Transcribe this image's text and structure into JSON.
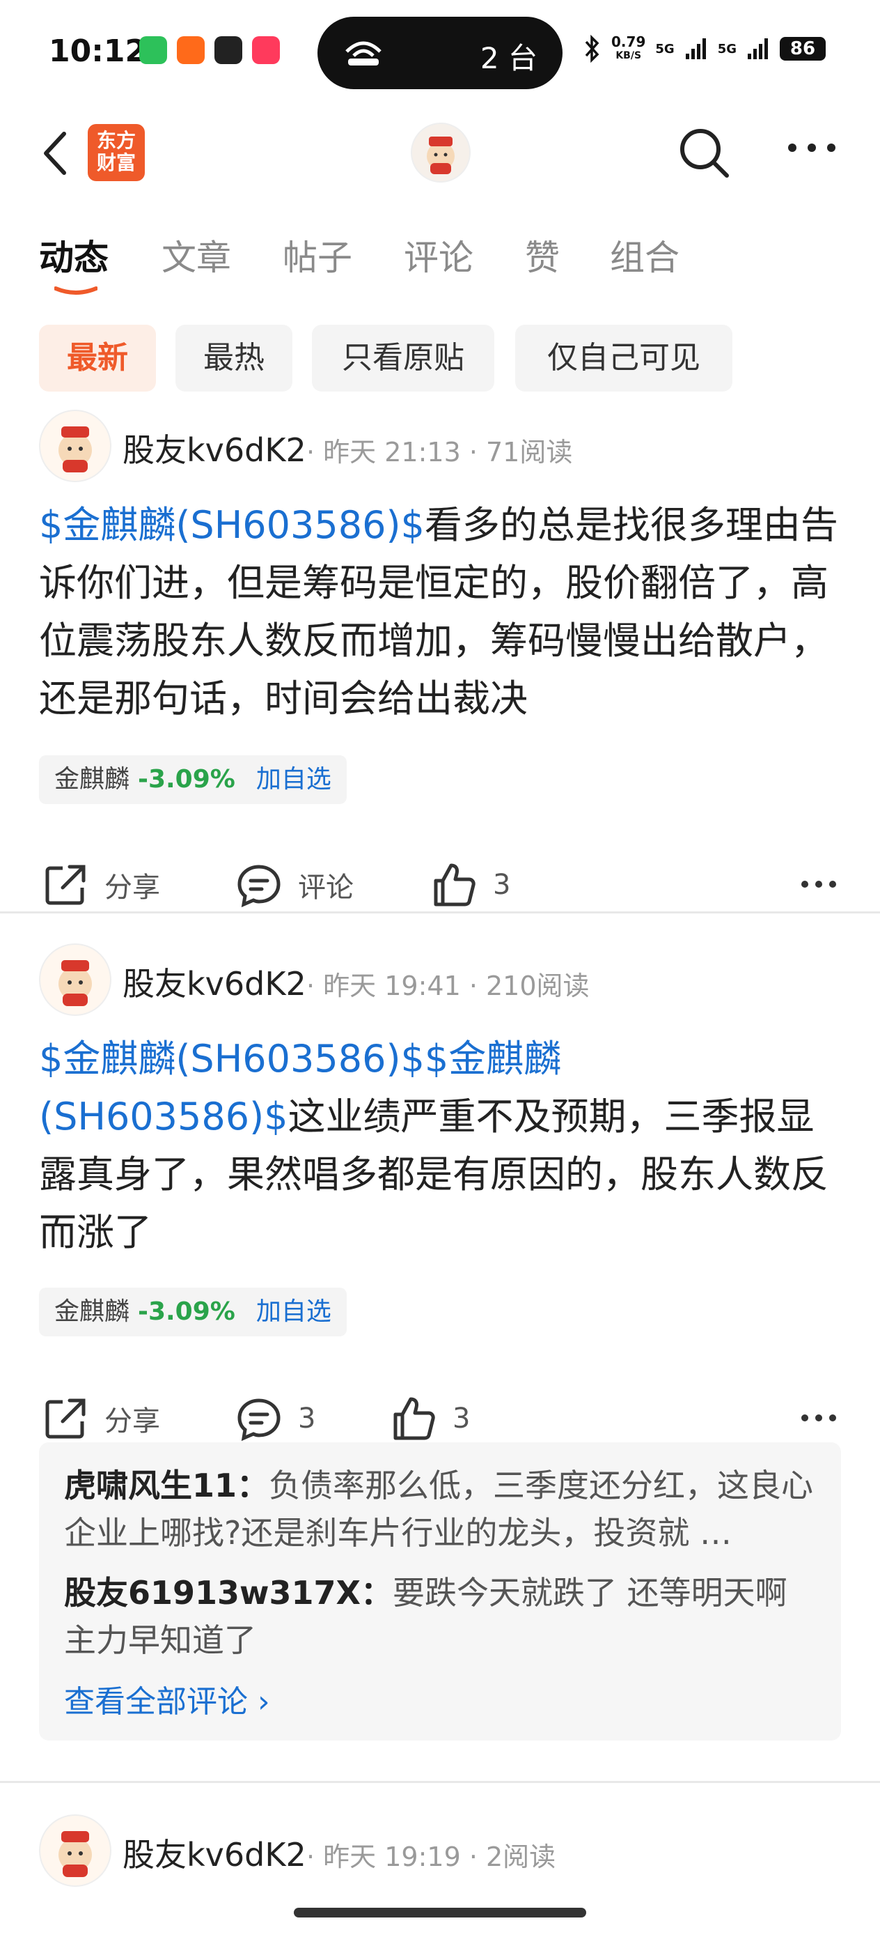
{
  "status_bar": {
    "time": "10:12",
    "pill_text": "2 台",
    "net_speed": "0.79",
    "net_unit": "KB/S",
    "signal1": "5G",
    "signal2": "5G",
    "battery": "86"
  },
  "nav": {
    "logo_line1": "东方",
    "logo_line2": "财富"
  },
  "tabs": [
    "动态",
    "文章",
    "帖子",
    "评论",
    "赞",
    "组合"
  ],
  "filters": [
    "最新",
    "最热",
    "只看原贴",
    "仅自己可见"
  ],
  "posts": [
    {
      "author": "股友kv6dK2",
      "meta": "· 昨天 21:13 · 71阅读",
      "stock_link": "$金麒麟(SH603586)$",
      "text": "看多的总是找很多理由告诉你们进，但是筹码是恒定的，股价翻倍了，高位震荡股东人数反而增加，筹码慢慢出给散户，还是那句话，时间会给出裁决",
      "tag_name": "金麒麟",
      "tag_change": "-3.09%",
      "tag_add": "加自选",
      "share_label": "分享",
      "comment_label": "评论",
      "like_count": "3"
    },
    {
      "author": "股友kv6dK2",
      "meta": "· 昨天 19:41 · 210阅读",
      "stock_link": "$金麒麟(SH603586)$$金麒麟(SH603586)$",
      "text": "这业绩严重不及预期，三季报显露真身了，果然唱多都是有原因的，股东人数反而涨了",
      "tag_name": "金麒麟",
      "tag_change": "-3.09%",
      "tag_add": "加自选",
      "share_label": "分享",
      "comment_count": "3",
      "like_count": "3",
      "comments": [
        {
          "user": "虎啸风生11：",
          "text": "负债率那么低，三季度还分红，这良心企业上哪找?还是刹车片行业的龙头，投资就 …"
        },
        {
          "user": "股友61913w317X：",
          "text": "要跌今天就跌了 还等明天啊 主力早知道了"
        }
      ],
      "view_all": "查看全部评论 ›"
    },
    {
      "author": "股友kv6dK2",
      "meta": "· 昨天 19:19 · 2阅读"
    }
  ]
}
